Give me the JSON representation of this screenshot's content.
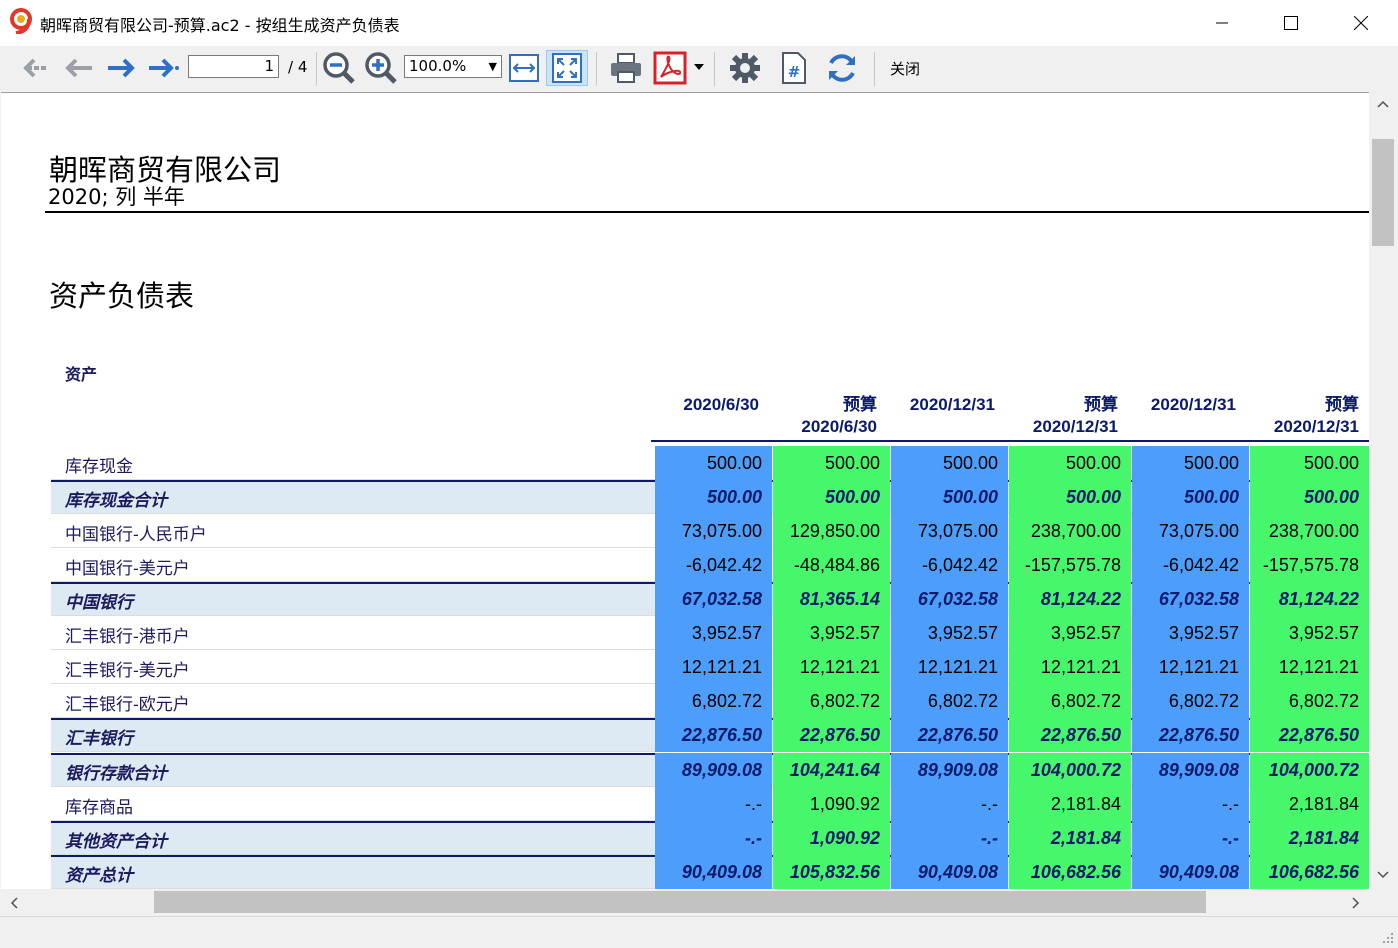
{
  "window": {
    "title": "朝晖商贸有限公司-预算.ac2 - 按组生成资产负债表",
    "minimize": "—",
    "maximize": "☐",
    "close": "✕"
  },
  "toolbar": {
    "page_current": "1",
    "page_total": "/ 4",
    "zoom": "100.0%",
    "close_label": "关闭"
  },
  "report": {
    "company": "朝晖商贸有限公司",
    "subtitle": "2020; 列 半年",
    "title": "资产负债表",
    "section": "资产",
    "columns": [
      {
        "line1": "2020/6/30",
        "line2": "",
        "kind": "actual"
      },
      {
        "line1": "预算",
        "line2": "2020/6/30",
        "kind": "budget"
      },
      {
        "line1": "2020/12/31",
        "line2": "",
        "kind": "actual"
      },
      {
        "line1": "预算",
        "line2": "2020/12/31",
        "kind": "budget"
      },
      {
        "line1": "2020/12/31",
        "line2": "",
        "kind": "actual"
      },
      {
        "line1": "预算",
        "line2": "2020/12/31",
        "kind": "budget"
      }
    ],
    "rows": [
      {
        "label": "库存现金",
        "total": false,
        "values": [
          "500.00",
          "500.00",
          "500.00",
          "500.00",
          "500.00",
          "500.00"
        ]
      },
      {
        "label": "库存现金合计",
        "total": true,
        "values": [
          "500.00",
          "500.00",
          "500.00",
          "500.00",
          "500.00",
          "500.00"
        ]
      },
      {
        "label": "中国银行-人民币户",
        "total": false,
        "values": [
          "73,075.00",
          "129,850.00",
          "73,075.00",
          "238,700.00",
          "73,075.00",
          "238,700.00"
        ]
      },
      {
        "label": "中国银行-美元户",
        "total": false,
        "values": [
          "-6,042.42",
          "-48,484.86",
          "-6,042.42",
          "-157,575.78",
          "-6,042.42",
          "-157,575.78"
        ]
      },
      {
        "label": "中国银行",
        "total": true,
        "values": [
          "67,032.58",
          "81,365.14",
          "67,032.58",
          "81,124.22",
          "67,032.58",
          "81,124.22"
        ]
      },
      {
        "label": "汇丰银行-港币户",
        "total": false,
        "values": [
          "3,952.57",
          "3,952.57",
          "3,952.57",
          "3,952.57",
          "3,952.57",
          "3,952.57"
        ]
      },
      {
        "label": "汇丰银行-美元户",
        "total": false,
        "values": [
          "12,121.21",
          "12,121.21",
          "12,121.21",
          "12,121.21",
          "12,121.21",
          "12,121.21"
        ]
      },
      {
        "label": "汇丰银行-欧元户",
        "total": false,
        "values": [
          "6,802.72",
          "6,802.72",
          "6,802.72",
          "6,802.72",
          "6,802.72",
          "6,802.72"
        ]
      },
      {
        "label": "汇丰银行",
        "total": true,
        "values": [
          "22,876.50",
          "22,876.50",
          "22,876.50",
          "22,876.50",
          "22,876.50",
          "22,876.50"
        ]
      },
      {
        "label": "银行存款合计",
        "total": true,
        "values": [
          "89,909.08",
          "104,241.64",
          "89,909.08",
          "104,000.72",
          "89,909.08",
          "104,000.72"
        ]
      },
      {
        "label": "库存商品",
        "total": false,
        "values": [
          "-.-",
          "1,090.92",
          "-.-",
          "2,181.84",
          "-.-",
          "2,181.84"
        ]
      },
      {
        "label": "其他资产合计",
        "total": true,
        "values": [
          "-.-",
          "1,090.92",
          "-.-",
          "2,181.84",
          "-.-",
          "2,181.84"
        ]
      },
      {
        "label": "资产总计",
        "total": true,
        "values": [
          "90,409.08",
          "105,832.56",
          "90,409.08",
          "106,682.56",
          "90,409.08",
          "106,682.56"
        ]
      }
    ]
  },
  "colors": {
    "actual": "#4d9dfa",
    "budget": "#46f76c",
    "total_row": "#ddeaf3",
    "header_text": "#0b1a6b"
  }
}
